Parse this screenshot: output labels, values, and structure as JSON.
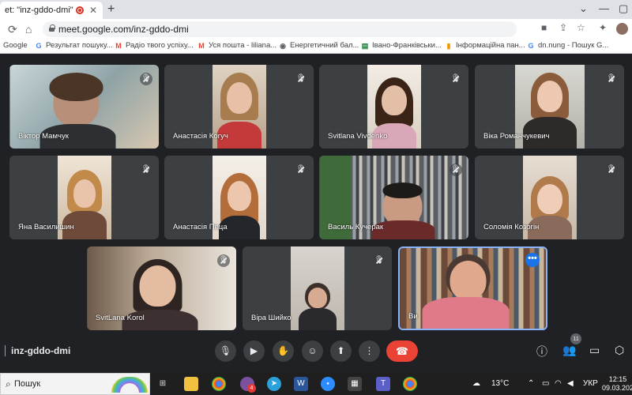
{
  "browser": {
    "tab_title": "et: \"inz-gddo-dmi\"",
    "tab_close": "✕",
    "new_tab": "+",
    "url": "meet.google.com/inz-gddo-dmi",
    "bookmarks": [
      {
        "label": "Google",
        "icon": "google-icon"
      },
      {
        "label": "Результат пошуку...",
        "icon": "google-icon"
      },
      {
        "label": "Радіо твого успіху...",
        "icon": "gmail-icon"
      },
      {
        "label": "Уся пошта - liliana...",
        "icon": "gmail-icon"
      },
      {
        "label": "Енергетичний бал...",
        "icon": "globe-icon"
      },
      {
        "label": "Івано-Франківськи...",
        "icon": "document-icon"
      },
      {
        "label": "Інформаційна пан...",
        "icon": "bookmark-icon"
      },
      {
        "label": "dn.nung - Пошук G...",
        "icon": "google-icon"
      }
    ]
  },
  "meet": {
    "participants": [
      {
        "name": "Віктор Мамчук",
        "muted": true
      },
      {
        "name": "Анастасія Когуч",
        "muted": true
      },
      {
        "name": "Svitlana Vivdenko",
        "muted": true
      },
      {
        "name": "Віка Романчукевич",
        "muted": true
      },
      {
        "name": "Яна Василишин",
        "muted": true
      },
      {
        "name": "Анастасія Пеца",
        "muted": true
      },
      {
        "name": "Василь Кучерак",
        "muted": true
      },
      {
        "name": "Соломія Козогін",
        "muted": true
      },
      {
        "name": "SvitLana Korol",
        "muted": true
      },
      {
        "name": "Віра Шийко",
        "muted": true
      },
      {
        "name": "Ви",
        "muted": false
      }
    ],
    "meeting_code": "inz-gddo-dmi",
    "participant_count": "11",
    "more_options": "•••",
    "accent_color": "#1a73e8",
    "hangup_color": "#ea4335"
  },
  "taskbar": {
    "search_placeholder": "Пошук",
    "weather": "13°C",
    "language": "УКР",
    "time": "12:15",
    "date": "09.03.202",
    "notification_badge": "4"
  }
}
